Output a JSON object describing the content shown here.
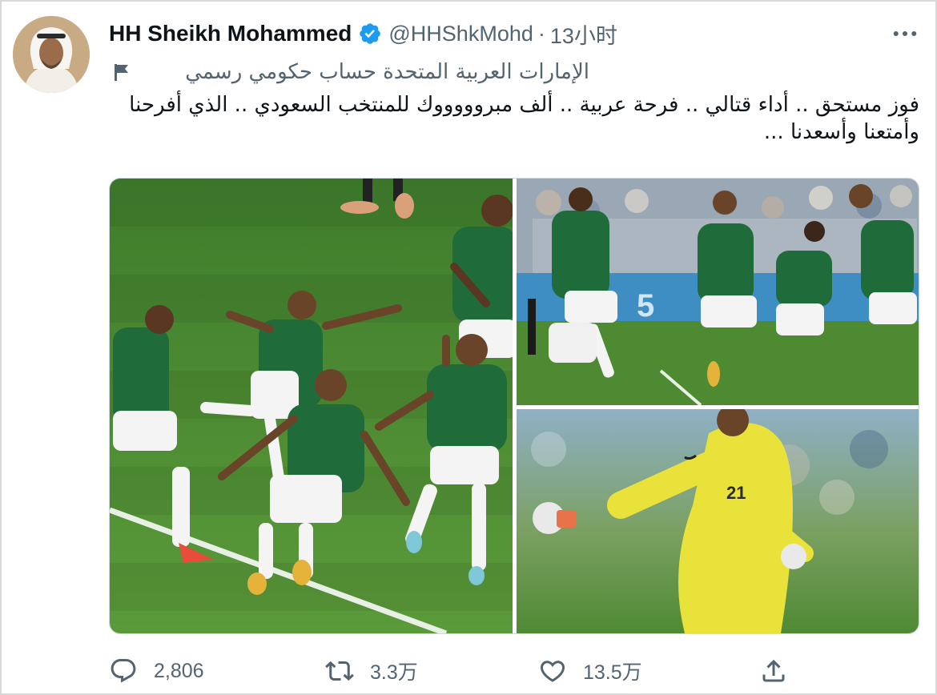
{
  "author": {
    "display_name": "HH Sheikh Mohammed",
    "handle": "@HHShkMohd",
    "separator": "·",
    "time": "13小时",
    "verified": true,
    "affiliation": "الإمارات العربية المتحدة حساب حكومي رسمي"
  },
  "tweet": {
    "text": "فوز مستحق .. أداء قتالي .. فرحة عربية .. ألف مبروووووك للمنتخب السعودي .. الذي أفرحنا وأمتعنا وأسعدنا ..."
  },
  "actions": {
    "reply_count": "2,806",
    "retweet_count": "3.3万",
    "like_count": "13.5万"
  },
  "colors": {
    "verified_blue": "#1d9bf0",
    "secondary_text": "#536471",
    "pitch_green": "#4d8a32",
    "jersey_green": "#1f6b3a",
    "keeper_yellow": "#e9e23a"
  },
  "icons": {
    "verified": "verified-badge-icon",
    "more": "more-icon",
    "affiliation": "flag-icon",
    "reply": "reply-icon",
    "retweet": "retweet-icon",
    "like": "heart-icon",
    "share": "share-icon"
  }
}
